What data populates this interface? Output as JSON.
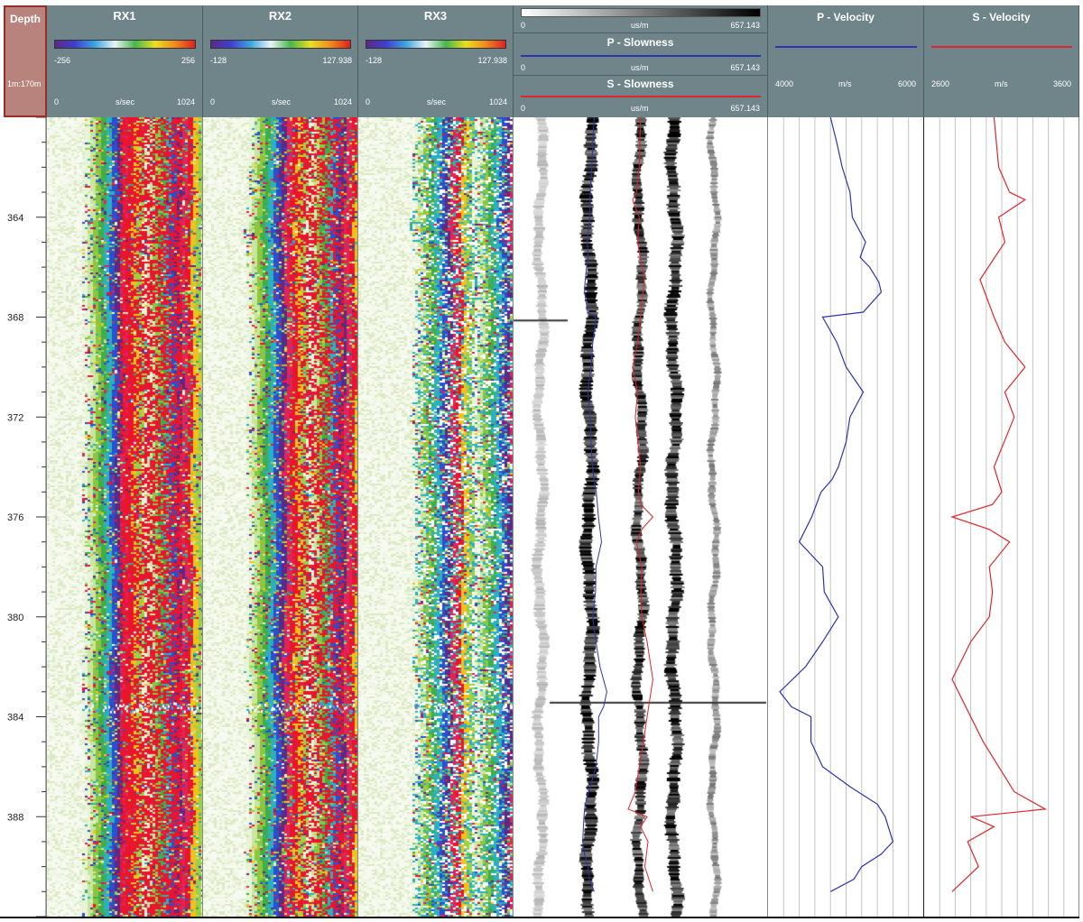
{
  "depth_track": {
    "title": "Depth",
    "scale": "1m:170m",
    "ticks": [
      "364",
      "368",
      "372",
      "376",
      "380",
      "384",
      "388"
    ]
  },
  "tracks": {
    "rx1": {
      "title": "RX1",
      "amp_min": "-256",
      "amp_max": "256",
      "time_min": "0",
      "time_unit": "s/sec",
      "time_max": "1024"
    },
    "rx2": {
      "title": "RX2",
      "amp_min": "-128",
      "amp_max": "127.938",
      "time_min": "0",
      "time_unit": "s/sec",
      "time_max": "1024"
    },
    "rx3": {
      "title": "RX3",
      "amp_min": "-128",
      "amp_max": "127.938",
      "time_min": "0",
      "time_unit": "s/sec",
      "time_max": "1024"
    },
    "slowness": {
      "image_min": "0",
      "image_unit": "us/m",
      "image_max": "657.143",
      "p_title": "P - Slowness",
      "p_min": "0",
      "p_unit": "us/m",
      "p_max": "657.143",
      "s_title": "S - Slowness",
      "s_min": "0",
      "s_unit": "us/m",
      "s_max": "657.143"
    },
    "p_velocity": {
      "title": "P - Velocity",
      "min": "4000",
      "unit": "m/s",
      "max": "6000"
    },
    "s_velocity": {
      "title": "S - Velocity",
      "min": "2600",
      "unit": "m/s",
      "max": "3600"
    }
  },
  "colors": {
    "header_bg": "#6f858a",
    "depth_header_bg": "#b8837c",
    "depth_header_border": "#9a2d25",
    "p_curve": "#2b35b0",
    "s_curve": "#e0252b",
    "grid": "#c4c4c4"
  },
  "chart_data": [
    {
      "type": "line",
      "series": [
        {
          "name": "P - Velocity",
          "x": [
            4800,
            4880,
            4950,
            5050,
            5080,
            5250,
            5180,
            5300,
            5420,
            5450,
            5220,
            4700,
            4880,
            5000,
            5220,
            5050,
            5000,
            4900,
            4820,
            4680,
            4560,
            4400,
            4700,
            4720,
            4900,
            4800,
            4700,
            4480,
            4150,
            4300,
            4550,
            4550,
            4700,
            5050,
            5400,
            5500,
            5600,
            5450,
            5200,
            5100,
            4800
          ],
          "y": [
            360,
            361,
            362,
            363,
            364,
            365,
            365.6,
            366,
            366.6,
            367,
            367.8,
            368,
            369,
            370,
            371,
            372,
            373,
            374,
            374.5,
            375,
            376,
            377,
            378,
            379,
            380,
            380.5,
            381,
            382,
            383,
            383.6,
            384,
            385,
            386,
            386.8,
            387.5,
            388,
            389,
            389.5,
            390,
            390.5,
            391
          ]
        }
      ],
      "xlim": [
        4000,
        6000
      ],
      "ylim": [
        360,
        392
      ]
    },
    {
      "type": "line",
      "series": [
        {
          "name": "S - Velocity",
          "x": [
            3050,
            3080,
            3150,
            3250,
            3080,
            3120,
            2960,
            3050,
            3120,
            3250,
            3120,
            3180,
            3050,
            3100,
            3040,
            2780,
            3020,
            3150,
            3020,
            3040,
            3020,
            2900,
            2780,
            2900,
            2980,
            3080,
            3180,
            3380,
            2900,
            3050,
            2880,
            2950,
            2780
          ],
          "y": [
            360,
            362,
            363,
            363.3,
            364,
            365,
            366.5,
            368,
            369,
            370,
            371,
            372,
            374,
            375,
            375.5,
            376,
            376.5,
            377,
            378,
            379,
            380,
            381,
            382.5,
            384,
            385,
            386,
            387,
            387.7,
            388,
            388.4,
            389,
            390,
            391
          ]
        }
      ],
      "xlim": [
        2600,
        3600
      ],
      "ylim": [
        360,
        392
      ]
    }
  ]
}
